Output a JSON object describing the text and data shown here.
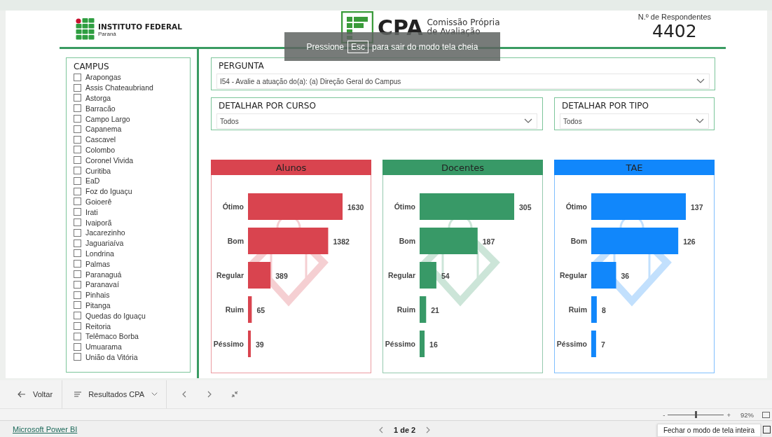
{
  "header": {
    "org_name": "INSTITUTO FEDERAL",
    "org_sub": "Paraná",
    "app_acronym": "CPA",
    "app_name_line1": "Comissão Própria",
    "app_name_line2": "de Avaliação",
    "respondents_label": "N.º de Respondentes",
    "respondents_value": "4402"
  },
  "fullscreen_hint": {
    "before": "Pressione",
    "key": "Esc",
    "after": "para sair do modo tela cheia"
  },
  "campus": {
    "title": "CAMPUS",
    "items": [
      {
        "label": "Arapongas",
        "checked": false
      },
      {
        "label": "Assis Chateaubriand",
        "checked": false
      },
      {
        "label": "Astorga",
        "checked": false
      },
      {
        "label": "Barracão",
        "checked": false
      },
      {
        "label": "Campo Largo",
        "checked": false
      },
      {
        "label": "Capanema",
        "checked": false
      },
      {
        "label": "Cascavel",
        "checked": false
      },
      {
        "label": "Colombo",
        "checked": false
      },
      {
        "label": "Coronel Vivida",
        "checked": false
      },
      {
        "label": "Curitiba",
        "checked": false
      },
      {
        "label": "EaD",
        "checked": false
      },
      {
        "label": "Foz do Iguaçu",
        "checked": false
      },
      {
        "label": "Goioerê",
        "checked": false
      },
      {
        "label": "Irati",
        "checked": false
      },
      {
        "label": "Ivaiporã",
        "checked": false
      },
      {
        "label": "Jacarezinho",
        "checked": false
      },
      {
        "label": "Jaguariaíva",
        "checked": false
      },
      {
        "label": "Londrina",
        "checked": false
      },
      {
        "label": "Palmas",
        "checked": false
      },
      {
        "label": "Paranaguá",
        "checked": false
      },
      {
        "label": "Paranavaí",
        "checked": false
      },
      {
        "label": "Pinhais",
        "checked": false
      },
      {
        "label": "Pitanga",
        "checked": false
      },
      {
        "label": "Quedas do Iguaçu",
        "checked": false
      },
      {
        "label": "Reitoria",
        "checked": false
      },
      {
        "label": "Telêmaco Borba",
        "checked": false
      },
      {
        "label": "Umuarama",
        "checked": false
      },
      {
        "label": "União da Vitória",
        "checked": false
      }
    ]
  },
  "pergunta": {
    "title": "PERGUNTA",
    "value": "I54 - Avalie a atuação do(a): (a) Direção Geral do Campus"
  },
  "detalhar_curso": {
    "title": "DETALHAR POR CURSO",
    "value": "Todos"
  },
  "detalhar_tipo": {
    "title": "DETALHAR POR TIPO",
    "value": "Todos"
  },
  "charts": [
    {
      "color": "#d9444f",
      "chart_data": {
        "type": "bar",
        "title": "Alunos",
        "orientation": "horizontal",
        "categories": [
          "Ótimo",
          "Bom",
          "Regular",
          "Ruim",
          "Péssimo"
        ],
        "values": [
          1630,
          1382,
          389,
          65,
          39
        ],
        "data_labels": true
      }
    },
    {
      "color": "#389967",
      "chart_data": {
        "type": "bar",
        "title": "Docentes",
        "orientation": "horizontal",
        "categories": [
          "Ótimo",
          "Bom",
          "Regular",
          "Ruim",
          "Péssimo"
        ],
        "values": [
          305,
          187,
          54,
          21,
          16
        ],
        "data_labels": true
      }
    },
    {
      "color": "#1187fb",
      "chart_data": {
        "type": "bar",
        "title": "TAE",
        "orientation": "horizontal",
        "categories": [
          "Ótimo",
          "Bom",
          "Regular",
          "Ruim",
          "Péssimo"
        ],
        "values": [
          137,
          126,
          36,
          8,
          7
        ],
        "data_labels": true
      }
    }
  ],
  "nav": {
    "back": "Voltar",
    "pages": "Resultados CPA"
  },
  "zoom": {
    "minus": "-",
    "plus": "+",
    "level": 0.5,
    "reading": "92%"
  },
  "footer": {
    "brand": "Microsoft Power BI",
    "page": "1 de 2",
    "tooltip": "Fechar o modo de tela inteira"
  }
}
